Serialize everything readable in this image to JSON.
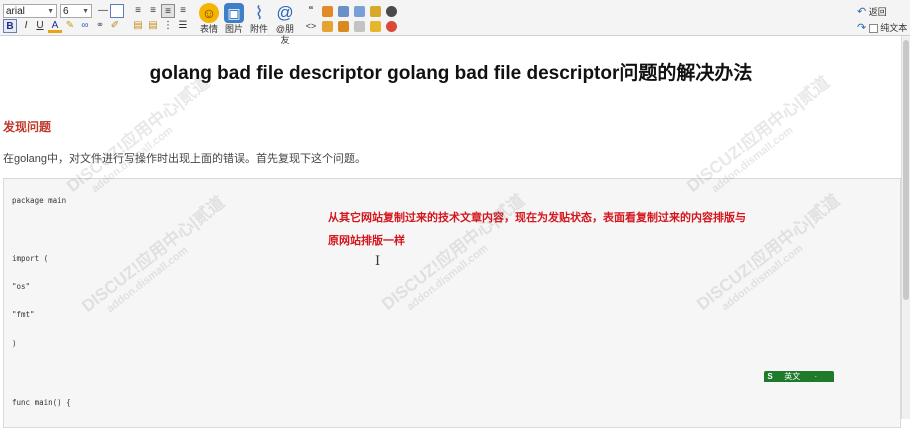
{
  "toolbar": {
    "font_family": "arial",
    "font_size": "6",
    "bold": "B",
    "italic": "I",
    "underline": "U",
    "text_color": "A",
    "emoji_label": "表情",
    "image_label": "图片",
    "attach_label": "附件",
    "mention_label": "@朋友",
    "quote_label": "“",
    "code_label": "<>",
    "back_label": "返回",
    "plaintext_label": "纯文本"
  },
  "editor": {
    "title": "golang bad file descriptor golang bad file descriptor问题的解决办法",
    "heading": "发现问题",
    "paragraph": "在golang中，对文件进行写操作时出现上面的错误。首先复现下这个问题。",
    "code_lines": [
      "package main",
      "import (",
      " \"os\"",
      " \"fmt\"",
      ")",
      "func main() {"
    ],
    "note_line1": "从其它网站复制过来的技术文章内容，现在为发贴状态，表面看复制过来的内容排版与",
    "note_line2": "原网站排版一样",
    "cursor": "I"
  },
  "watermark": {
    "main": "DISCUZ!应用中心|贰道",
    "sub": "addon.dismall.com"
  },
  "ime": {
    "icon": "S",
    "lang": "英文",
    "extra": "·"
  }
}
